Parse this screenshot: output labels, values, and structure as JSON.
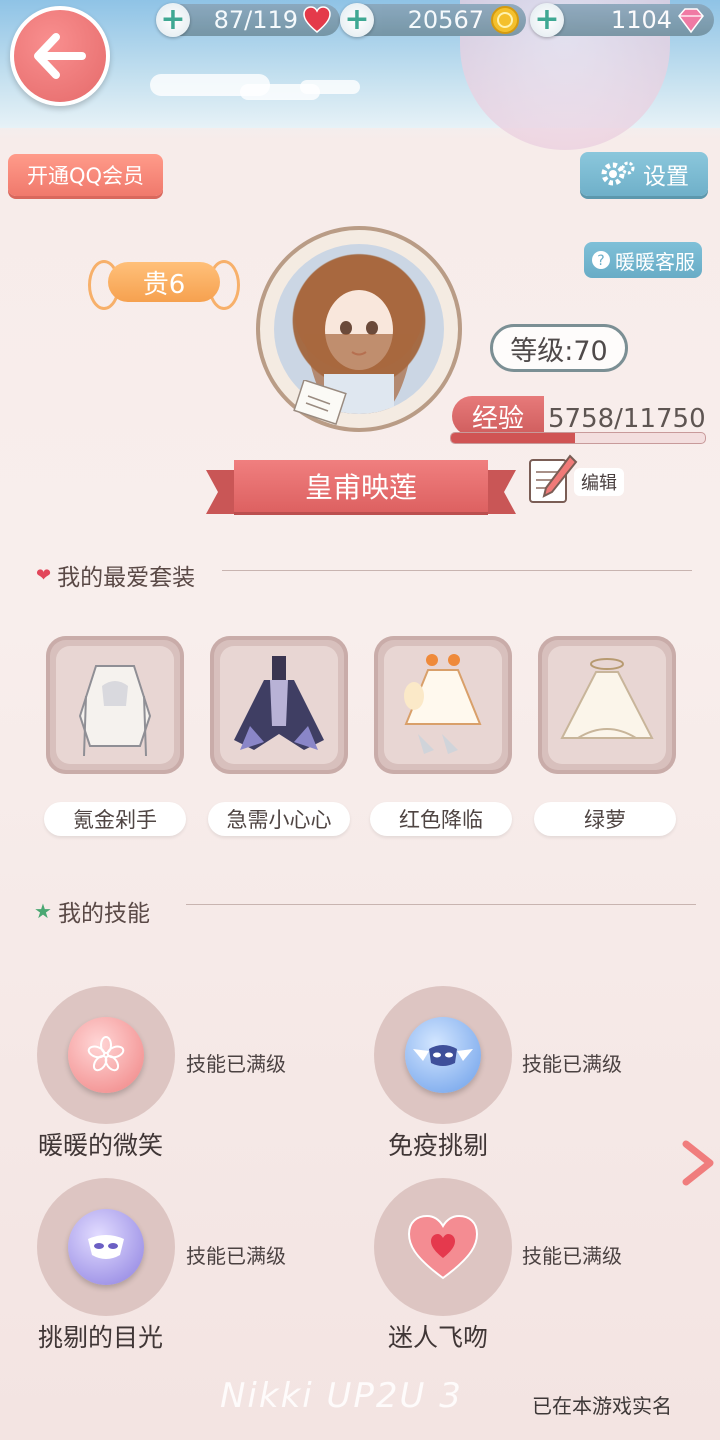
{
  "resources": {
    "stamina": "87/119",
    "gold": "20567",
    "diamonds": "1104"
  },
  "buttons": {
    "qq_member": "开通QQ会员",
    "settings": "设置",
    "customer_service": "暖暖客服",
    "edit": "编辑"
  },
  "profile": {
    "vip": "贵6",
    "level": "等级:70",
    "exp_label": "经验",
    "exp_value": "5758/11750",
    "exp_progress": 0.49,
    "name": "皇甫映莲"
  },
  "favorites": {
    "title": "我的最爱套装",
    "items": [
      {
        "label": "氪金剁手"
      },
      {
        "label": "急需小心心"
      },
      {
        "label": "红色降临"
      },
      {
        "label": "绿萝"
      }
    ]
  },
  "skills": {
    "title": "我的技能",
    "items": [
      {
        "name": "暖暖的微笑",
        "status": "技能已满级",
        "icon": "sakura-icon"
      },
      {
        "name": "免疫挑剔",
        "status": "技能已满级",
        "icon": "winged-mask-icon"
      },
      {
        "name": "挑剔的目光",
        "status": "技能已满级",
        "icon": "mask-icon"
      },
      {
        "name": "迷人飞吻",
        "status": "技能已满级",
        "icon": "heart-icon"
      }
    ]
  },
  "footer": {
    "realname": "已在本游戏实名",
    "watermark": "Nikki UP2U 3"
  },
  "colors": {
    "accent_red": "#dd6161",
    "accent_blue": "#6fb0c9",
    "vip_orange": "#f6a14f"
  }
}
